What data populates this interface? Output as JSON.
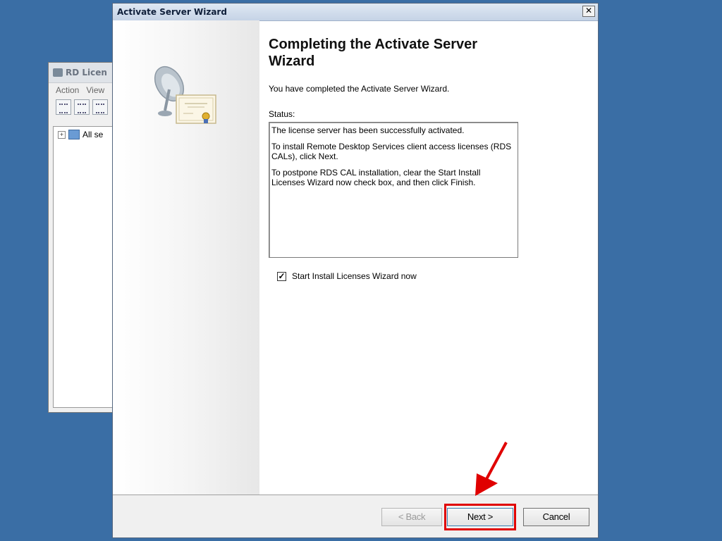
{
  "background_window": {
    "title": "RD Licen",
    "menu": [
      "Action",
      "View"
    ],
    "tree_item": "All se"
  },
  "wizard": {
    "title": "Activate Server Wizard",
    "close_glyph": "✕",
    "heading": "Completing the Activate Server Wizard",
    "description": "You have completed the Activate Server Wizard.",
    "status_label": "Status:",
    "status_paragraphs": [
      "The license server has been successfully activated.",
      "To install Remote Desktop Services client access licenses (RDS CALs), click Next.",
      "To postpone RDS CAL installation, clear the Start Install Licenses Wizard now check box, and then click Finish."
    ],
    "checkbox": {
      "label": "Start Install Licenses Wizard now",
      "checked": true
    },
    "buttons": {
      "back": "< Back",
      "next": "Next >",
      "cancel": "Cancel"
    }
  },
  "annotation": {
    "highlight_color": "#e00000",
    "target": "Next >"
  },
  "colors": {
    "desktop": "#3a6ea5",
    "accent_red": "#e00000"
  }
}
